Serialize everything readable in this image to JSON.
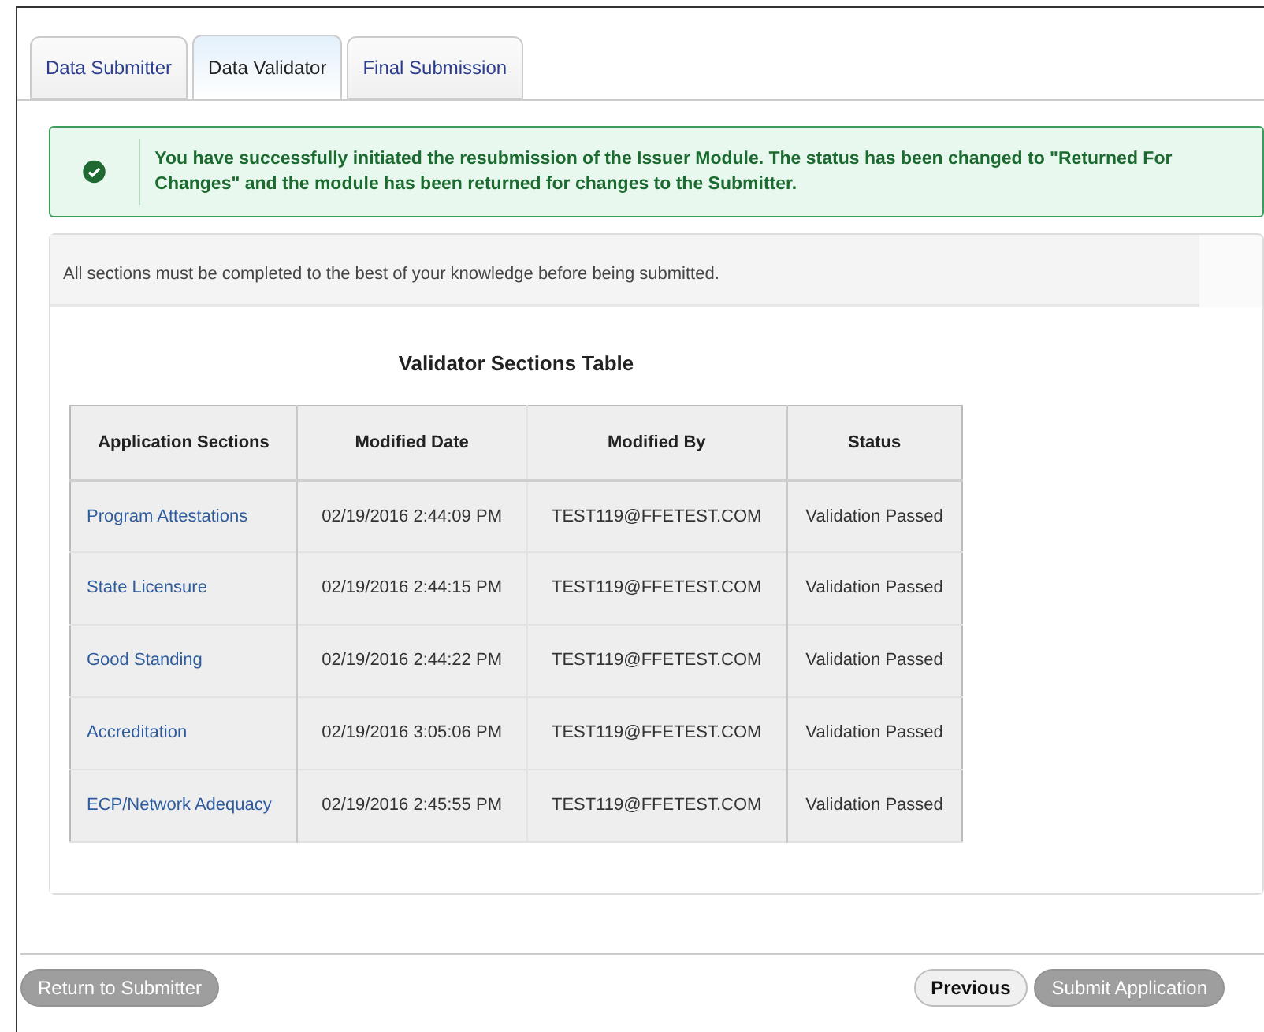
{
  "tabs": [
    {
      "label": "Data Submitter",
      "selected": false
    },
    {
      "label": "Data Validator",
      "selected": true
    },
    {
      "label": "Final Submission",
      "selected": false
    }
  ],
  "alert": {
    "message": "You have successfully initiated the resubmission of the Issuer Module. The status has been changed to \"Returned For Changes\" and the module has been returned for changes to the Submitter."
  },
  "instructions": "All sections must be completed to the best of your knowledge before being submitted.",
  "table": {
    "title": "Validator Sections Table",
    "columns": [
      "Application Sections",
      "Modified Date",
      "Modified By",
      "Status"
    ],
    "rows": [
      [
        "Program Attestations",
        "02/19/2016 2:44:09 PM",
        "TEST119@FFETEST.COM",
        "Validation Passed"
      ],
      [
        "State Licensure",
        "02/19/2016 2:44:15 PM",
        "TEST119@FFETEST.COM",
        "Validation Passed"
      ],
      [
        "Good Standing",
        "02/19/2016 2:44:22 PM",
        "TEST119@FFETEST.COM",
        "Validation Passed"
      ],
      [
        "Accreditation",
        "02/19/2016 3:05:06 PM",
        "TEST119@FFETEST.COM",
        "Validation Passed"
      ],
      [
        "ECP/Network Adequacy",
        "02/19/2016 2:45:55 PM",
        "TEST119@FFETEST.COM",
        "Validation Passed"
      ]
    ]
  },
  "buttons_left": [
    {
      "label": "Return to Submitter",
      "disabled": true
    }
  ],
  "buttons_right": [
    {
      "label": "Previous",
      "disabled": false
    },
    {
      "label": "Submit Application",
      "disabled": true
    }
  ]
}
